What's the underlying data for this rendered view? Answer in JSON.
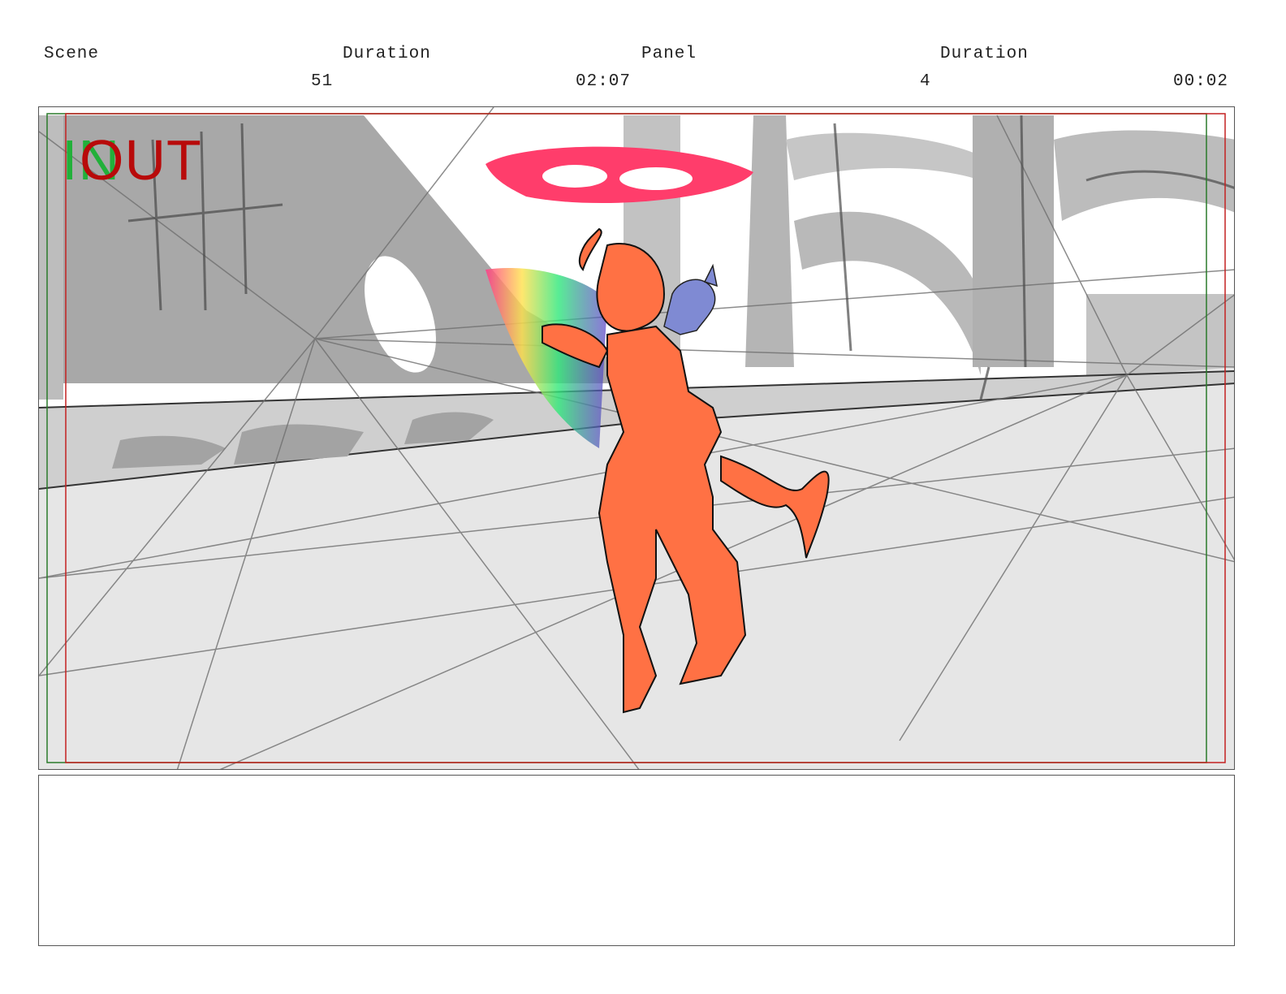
{
  "header": {
    "scene_label": "Scene",
    "scene_value": "51",
    "scene_duration_label": "Duration",
    "scene_duration_value": "02:07",
    "panel_label": "Panel",
    "panel_value": "4",
    "panel_duration_label": "Duration",
    "panel_duration_value": "00:02"
  },
  "frame": {
    "in_label": "IN",
    "out_label": "OUT",
    "in_color": "#22b03a",
    "out_color": "#b80a0a"
  },
  "notes": {
    "text": ""
  }
}
